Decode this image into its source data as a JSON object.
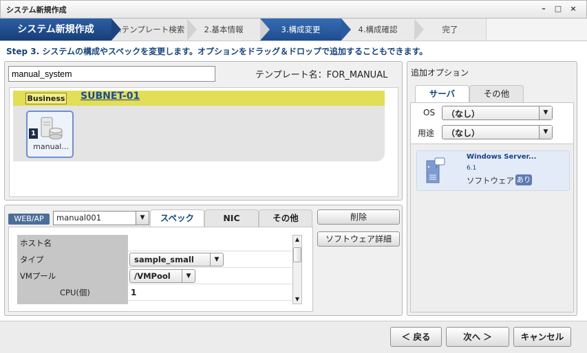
{
  "window": {
    "title": "システム新規作成",
    "controls": [
      "–",
      "□",
      "×"
    ]
  },
  "wizard": {
    "current_title": "システム新規作成",
    "steps": [
      {
        "label": "1.テンプレート検索"
      },
      {
        "label": "2.基本情報"
      },
      {
        "label": "3.構成変更"
      },
      {
        "label": "4.構成確認"
      },
      {
        "label": "完了"
      }
    ],
    "active_step": 3
  },
  "instruction": "Step 3. システムの構成やスペックを変更します。オプションをドラッグ＆ドロップで追加することもできます。",
  "system": {
    "name_value": "manual_system",
    "template_label": "テンプレート名：FOR_MANUAL"
  },
  "canvas": {
    "subnet_badge": "Business",
    "subnet_name": "SUBNET-01",
    "server": {
      "number": "1",
      "name": "manual..."
    }
  },
  "server_detail": {
    "role_badge": "WEB/AP",
    "selected_server": "manual001",
    "tabs": [
      "スペック",
      "NIC",
      "その他"
    ],
    "rows": [
      {
        "label": "ホスト名",
        "value": ""
      },
      {
        "label": "タイプ",
        "value": "sample_small"
      },
      {
        "label": "VMプール",
        "value": "/VMPool"
      },
      {
        "label": "CPU(個)",
        "value": "1"
      }
    ],
    "delete_label": "削除",
    "swdetail_label": "ソフトウェア詳細"
  },
  "options": {
    "title": "追加オプション",
    "tabs": [
      "サーバ",
      "その他"
    ],
    "os_label": "OS",
    "os_value": "（なし）",
    "usage_label": "用途",
    "usage_value": "（なし）",
    "item": {
      "name": "Windows Server...",
      "version": "6.1",
      "type": "ソフトウェア",
      "flag": "あり"
    }
  },
  "footer": {
    "back_label": "＜ 戻る",
    "next_label": "次へ ＞",
    "cancel_label": "キャンセル"
  },
  "icons": {
    "dropdown": "▼",
    "scroll_up": "▲",
    "scroll_down": "▼"
  }
}
